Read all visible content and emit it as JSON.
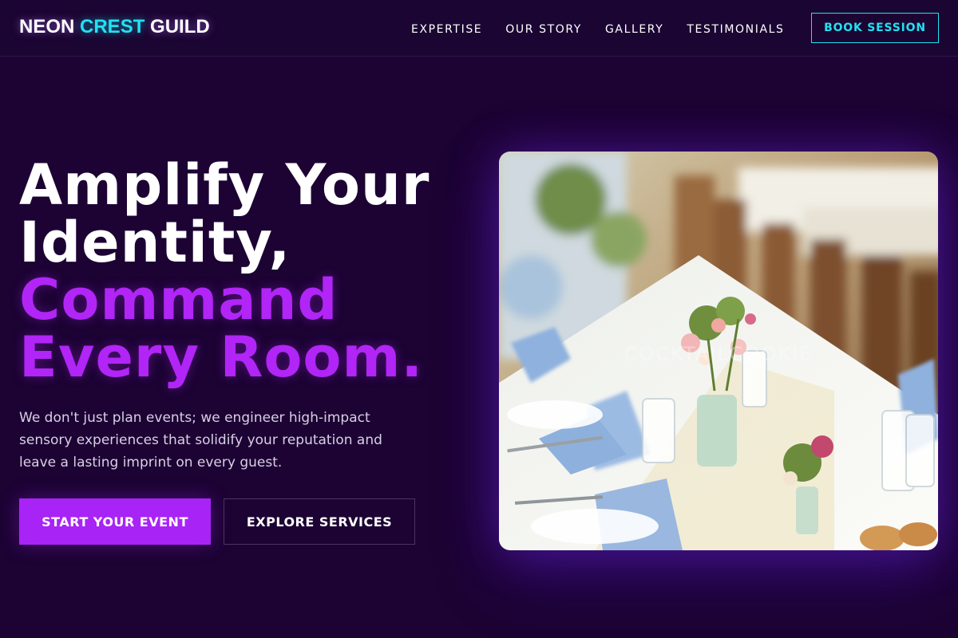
{
  "header": {
    "logo": {
      "part1": "NEON",
      "part2": "CREST",
      "part3": "GUILD"
    },
    "nav": [
      "EXPERTISE",
      "OUR STORY",
      "GALLERY",
      "TESTIMONIALS"
    ],
    "cta_label": "BOOK SESSION"
  },
  "hero": {
    "headline_line1": "Amplify Your",
    "headline_line2": "Identity,",
    "headline_line3": "Command",
    "headline_line4": "Every Room.",
    "subtext": "We don't just plan events; we engineer high-impact sensory experiences that solidify your reputation and leave a lasting imprint on every guest.",
    "primary_cta": "START YOUR EVENT",
    "secondary_cta": "EXPLORE SERVICES",
    "image_watermark": "COCKTAILCOOKIE"
  },
  "colors": {
    "background": "#1c0333",
    "accent_purple": "#b125f7",
    "accent_cyan": "#22e1f2",
    "text": "#ffffff"
  }
}
